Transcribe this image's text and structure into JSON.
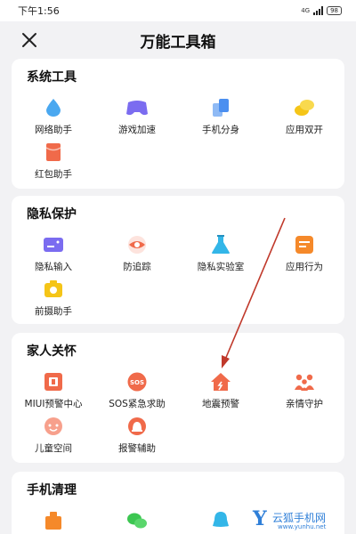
{
  "status_bar": {
    "time": "下午1:56",
    "network": "4G",
    "battery": "98"
  },
  "header": {
    "title": "万能工具箱",
    "close_icon": "close-icon"
  },
  "sections": [
    {
      "title": "系统工具",
      "items": [
        {
          "label": "网络助手",
          "icon": "water-drop-icon",
          "color": "#4aa8f0"
        },
        {
          "label": "游戏加速",
          "icon": "gamepad-icon",
          "color": "#7b6cf0"
        },
        {
          "label": "手机分身",
          "icon": "duplicate-phone-icon",
          "color": "#4b8ff0"
        },
        {
          "label": "应用双开",
          "icon": "double-coin-icon",
          "color": "#f5c518"
        },
        {
          "label": "红包助手",
          "icon": "red-envelope-icon",
          "color": "#f06a4a"
        }
      ]
    },
    {
      "title": "隐私保护",
      "items": [
        {
          "label": "隐私输入",
          "icon": "private-keyboard-icon",
          "color": "#7b6cf0"
        },
        {
          "label": "防追踪",
          "icon": "anti-tracking-eye-icon",
          "color": "#f06a4a"
        },
        {
          "label": "隐私实验室",
          "icon": "flask-icon",
          "color": "#33b6e8"
        },
        {
          "label": "应用行为",
          "icon": "app-behavior-icon",
          "color": "#f5892a"
        },
        {
          "label": "前摄助手",
          "icon": "front-camera-icon",
          "color": "#f5c518"
        }
      ]
    },
    {
      "title": "家人关怀",
      "items": [
        {
          "label": "MIUI预警中心",
          "icon": "alert-center-icon",
          "color": "#f06a4a"
        },
        {
          "label": "SOS紧急求助",
          "icon": "sos-icon",
          "color": "#f06a4a"
        },
        {
          "label": "地震预警",
          "icon": "earthquake-house-icon",
          "color": "#f06a4a"
        },
        {
          "label": "亲情守护",
          "icon": "family-icon",
          "color": "#f06a4a"
        },
        {
          "label": "儿童空间",
          "icon": "child-space-icon",
          "color": "#f06a4a"
        },
        {
          "label": "报警辅助",
          "icon": "alarm-assist-icon",
          "color": "#f06a4a"
        }
      ]
    },
    {
      "title": "手机清理",
      "items": [
        {
          "icon": "clean-bag-icon",
          "color": "#f5892a"
        },
        {
          "icon": "wechat-clean-icon",
          "color": "#3cc651"
        },
        {
          "icon": "qq-clean-icon",
          "color": "#33b6e8"
        }
      ]
    }
  ],
  "watermark": {
    "letter": "Y",
    "text": "云狐手机网",
    "url": "www.yunhu.net"
  }
}
